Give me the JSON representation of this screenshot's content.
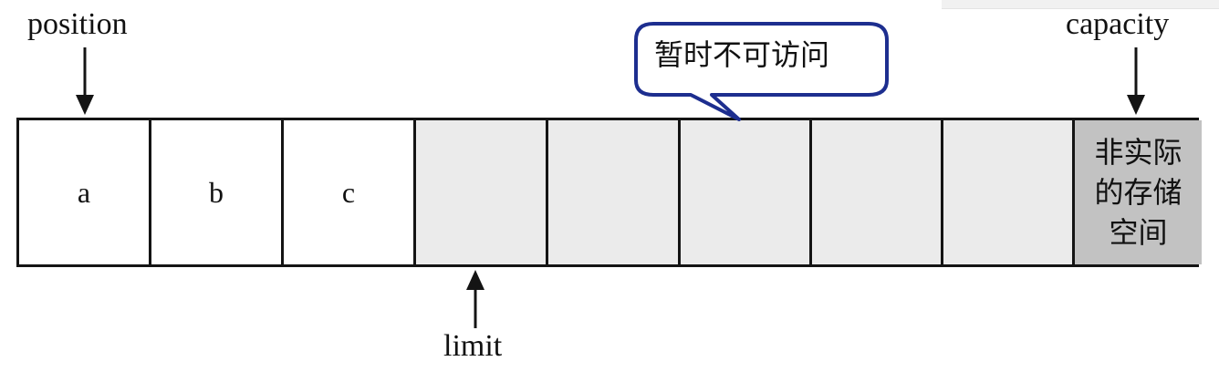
{
  "labels": {
    "position": "position",
    "capacity": "capacity",
    "limit": "limit"
  },
  "callout": {
    "text": "暂时不可访问",
    "border_color": "#1d2e8f"
  },
  "cells": [
    {
      "text": "a",
      "state": "filled"
    },
    {
      "text": "b",
      "state": "filled"
    },
    {
      "text": "c",
      "state": "filled"
    },
    {
      "text": "",
      "state": "inaccessible"
    },
    {
      "text": "",
      "state": "inaccessible"
    },
    {
      "text": "",
      "state": "inaccessible"
    },
    {
      "text": "",
      "state": "inaccessible"
    },
    {
      "text": "",
      "state": "inaccessible"
    },
    {
      "text": "非实际的存储空间",
      "state": "reserved"
    }
  ],
  "colors": {
    "filled": "#ffffff",
    "inaccessible": "#ebebeb",
    "reserved": "#c2c2c2",
    "stroke": "#141414"
  }
}
